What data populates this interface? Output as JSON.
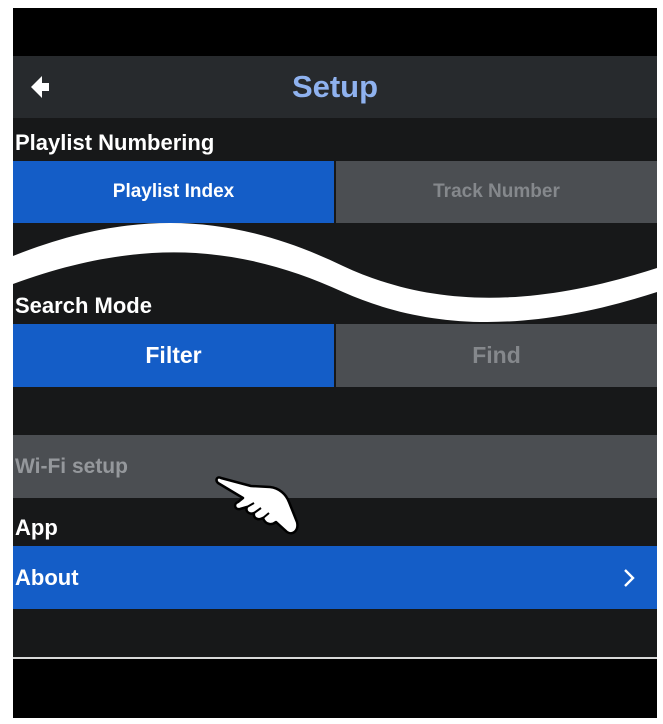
{
  "header": {
    "title": "Setup",
    "back_icon": "back-arrow-icon"
  },
  "sections": {
    "playlist_numbering": {
      "label": "Playlist Numbering",
      "options": [
        "Playlist Index",
        "Track Number"
      ],
      "selected": "Playlist Index"
    },
    "search_mode": {
      "label": "Search Mode",
      "options": [
        "Filter",
        "Find"
      ],
      "selected": "Filter"
    },
    "wifi": {
      "label": "Wi-Fi setup"
    },
    "app": {
      "label": "App"
    },
    "about": {
      "label": "About",
      "chevron_icon": "chevron-right-icon"
    }
  },
  "overlay": {
    "cursor_icon": "pointing-hand-icon",
    "break_icon": "wave-break-icon"
  },
  "colors": {
    "accent": "#145dc7",
    "background": "#171819",
    "header_bg": "#272a2d",
    "inactive_bg": "#4b4e52",
    "title": "#8fb2ef"
  }
}
